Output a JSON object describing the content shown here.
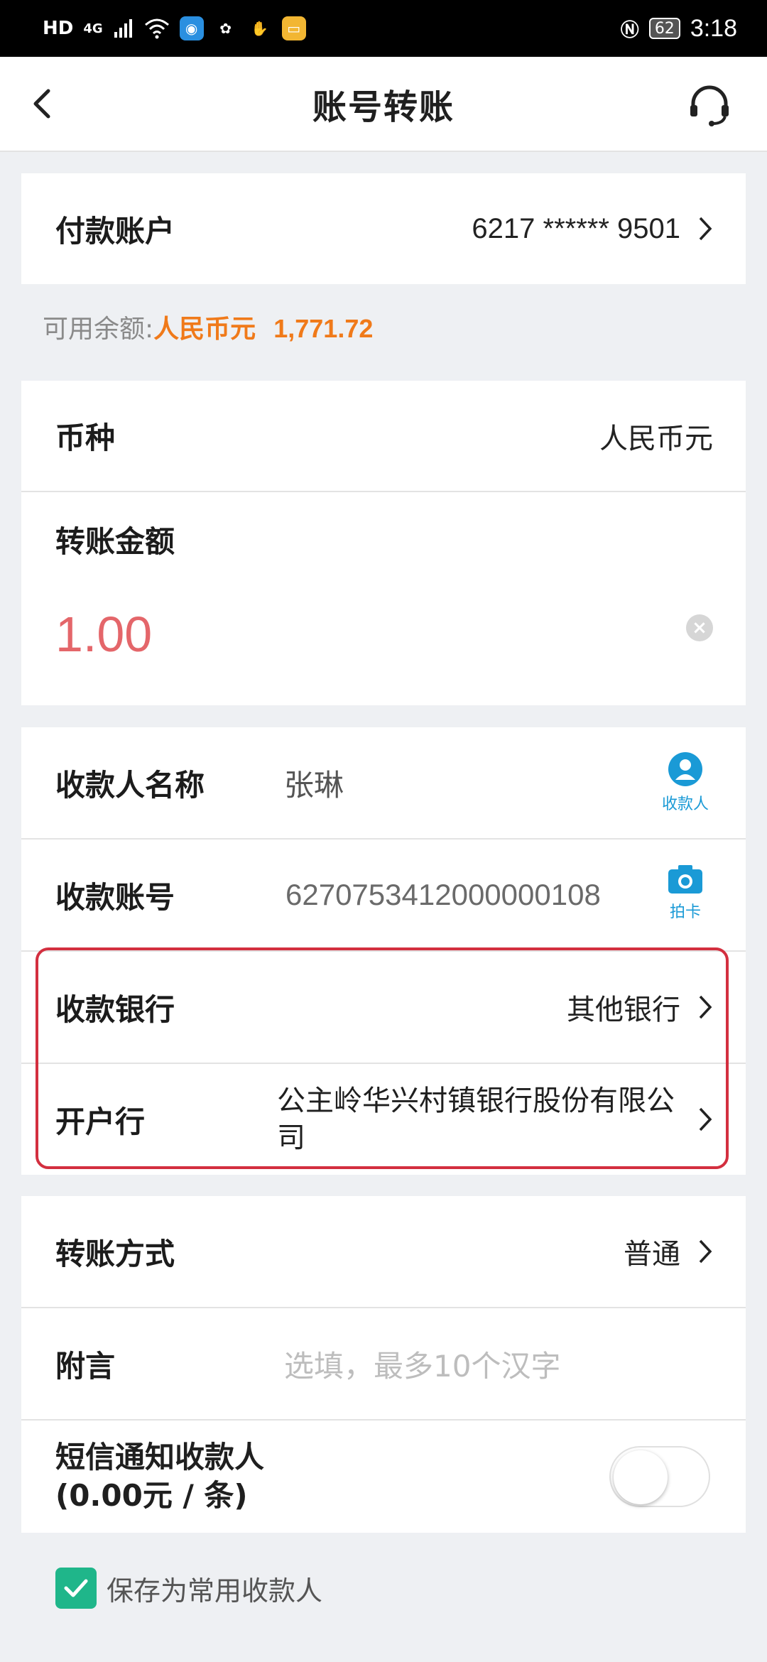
{
  "status_bar": {
    "left_texts": [
      "HD",
      "4G"
    ],
    "battery": "62",
    "time": "3:18"
  },
  "header": {
    "title": "账号转账"
  },
  "payer": {
    "label": "付款账户",
    "account": "6217 ****** 9501"
  },
  "balance": {
    "label": "可用余额:",
    "currency": "人民币元",
    "amount": "1,771.72"
  },
  "currency": {
    "label": "币种",
    "value": "人民币元"
  },
  "amount": {
    "label": "转账金额",
    "value": "1.00"
  },
  "payee": {
    "name_label": "收款人名称",
    "name_value": "张琳",
    "name_icon_caption": "收款人",
    "account_label": "收款账号",
    "account_value": "6270753412000000108",
    "account_icon_caption": "拍卡",
    "bank_label": "收款银行",
    "bank_value": "其他银行",
    "branch_label": "开户行",
    "branch_value": "公主岭华兴村镇银行股份有限公司"
  },
  "transfer": {
    "method_label": "转账方式",
    "method_value": "普通",
    "note_label": "附言",
    "note_placeholder": "选填，最多10个汉字",
    "sms_label_line1": "短信通知收款人",
    "sms_label_line2": "(0.00元 / 条)"
  },
  "save": {
    "label": "保存为常用收款人"
  },
  "colors": {
    "accent_orange": "#f07a1a",
    "amount_red": "#e4666a",
    "icon_blue": "#1a9ad6",
    "check_green": "#1fb68a",
    "highlight_red": "#d32f3f"
  }
}
